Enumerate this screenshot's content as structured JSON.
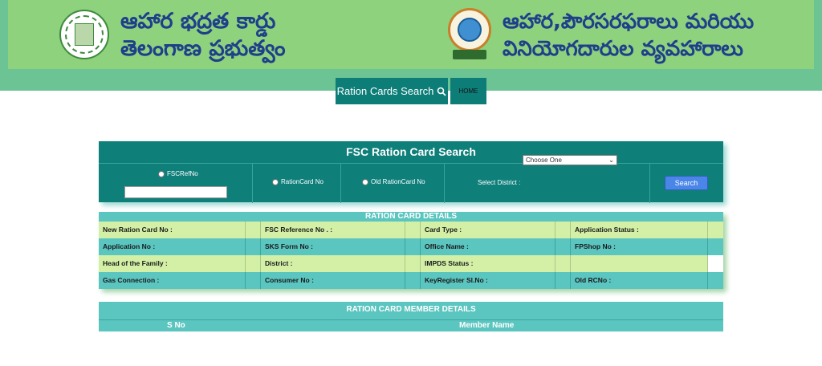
{
  "header": {
    "title_left_line1": "ఆహార భద్రత కార్డు",
    "title_left_line2": "తెలంగాణ ప్రభుత్వం",
    "title_right_line1": "ఆహార,పౌరసరఫరాలు మరియు",
    "title_right_line2": "వినియోగదారుల వ్యవహారాలు",
    "colors": {
      "banner_outer": "#6cc494",
      "banner_inner": "#8ed27e",
      "title": "#1f3f8a"
    }
  },
  "nav": {
    "search_label": "Ration Cards Search",
    "home_label": "HOME",
    "color": "#0d7d78"
  },
  "search_panel": {
    "title": "FSC Ration Card Search",
    "options": {
      "fsc_ref": "FSCRefNo",
      "ration_card": "RationCard No",
      "old_ration_card": "Old RationCard No"
    },
    "district_label": "Select District :",
    "district_value": "Choose One",
    "search_button": "Search"
  },
  "details": {
    "title": "RATION CARD DETAILS",
    "rows": [
      [
        "New Ration Card No :",
        "FSC Reference No . :",
        "Card Type :",
        "Application Status :"
      ],
      [
        "Application No :",
        "SKS Form No :",
        "Office Name :",
        "FPShop No :"
      ],
      [
        "Head of the Family :",
        "District :",
        "IMPDS Status :",
        ""
      ],
      [
        "Gas Connection :",
        "Consumer No :",
        "KeyRegister Sl.No :",
        "Old RCNo :"
      ]
    ]
  },
  "members": {
    "title": "RATION CARD MEMBER DETAILS",
    "columns": [
      "S No",
      "Member Name"
    ]
  }
}
